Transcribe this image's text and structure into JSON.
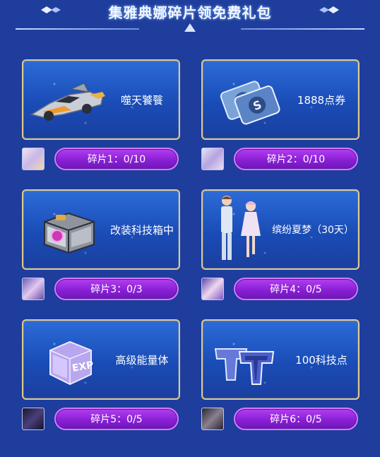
{
  "header": {
    "title": "集雅典娜碎片领免费礼包"
  },
  "rewards": [
    {
      "name": "噬天饕餮",
      "fragment_label": "碎片1：0/10",
      "image": "race-car"
    },
    {
      "name": "1888点券",
      "fragment_label": "碎片2：0/10",
      "image": "coupon-cards"
    },
    {
      "name": "改装科技箱中",
      "fragment_label": "碎片3：0/3",
      "image": "tech-chest"
    },
    {
      "name": "缤纷夏梦（30天）",
      "fragment_label": "碎片4：0/5",
      "image": "couple-outfit"
    },
    {
      "name": "高级能量体",
      "fragment_label": "碎片5：0/5",
      "image": "exp-cube"
    },
    {
      "name": "100科技点",
      "fragment_label": "碎片6：0/5",
      "image": "tech-point-tokens"
    }
  ],
  "colors": {
    "background": "#1e3d9c",
    "card_border": "#e0c98b",
    "button": "#8a20d6"
  },
  "exp_cube_text": "EXP"
}
